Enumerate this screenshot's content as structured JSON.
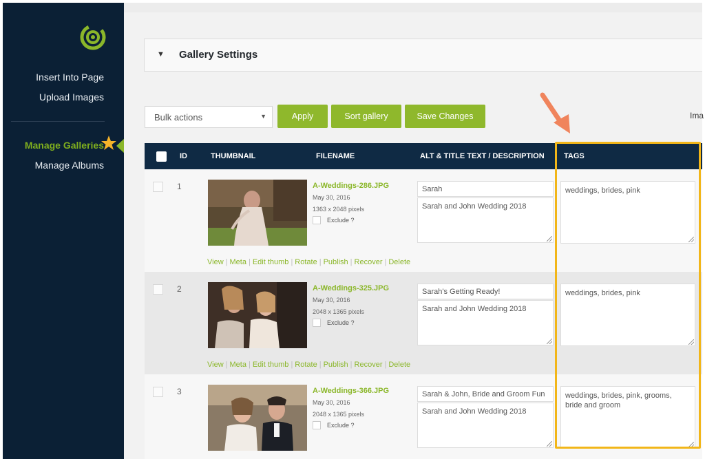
{
  "sidebar": {
    "logo_icon": "nextgen-logo-icon",
    "items": [
      {
        "label": "Insert Into Page"
      },
      {
        "label": "Upload Images"
      },
      {
        "label": "Manage Galleries",
        "active": true
      },
      {
        "label": "Manage Albums"
      }
    ]
  },
  "gallery_settings": {
    "title": "Gallery Settings"
  },
  "toolbar": {
    "bulk_actions": "Bulk actions",
    "apply": "Apply",
    "sort_gallery": "Sort gallery",
    "save_changes": "Save Changes",
    "truncated_label": "Ima"
  },
  "table": {
    "headers": {
      "id": "ID",
      "thumbnail": "THUMBNAIL",
      "filename": "FILENAME",
      "alt": "ALT & TITLE TEXT / DESCRIPTION",
      "tags": "TAGS"
    },
    "rows": [
      {
        "id": "1",
        "filename": "A-Weddings-286.JPG",
        "date": "May 30, 2016",
        "dimensions": "1363 x 2048 pixels",
        "exclude": "Exclude ?",
        "alt": "Sarah",
        "description": "Sarah and John Wedding 2018",
        "tags": "weddings, brides, pink"
      },
      {
        "id": "2",
        "filename": "A-Weddings-325.JPG",
        "date": "May 30, 2016",
        "dimensions": "2048 x 1365 pixels",
        "exclude": "Exclude ?",
        "alt": "Sarah's Getting Ready!",
        "description": "Sarah and John Wedding 2018",
        "tags": "weddings, brides, pink"
      },
      {
        "id": "3",
        "filename": "A-Weddings-366.JPG",
        "date": "May 30, 2016",
        "dimensions": "2048 x 1365 pixels",
        "exclude": "Exclude ?",
        "alt": "Sarah & John, Bride and Groom Fun",
        "description": "Sarah and John Wedding 2018",
        "tags": "weddings, brides, pink, grooms, bride and groom"
      }
    ],
    "row_actions": [
      "View",
      "Meta",
      "Edit thumb",
      "Rotate",
      "Publish",
      "Recover",
      "Delete"
    ]
  },
  "colors": {
    "sidebar_bg": "#0b2035",
    "accent_green": "#8bb72a",
    "header_bg": "#0f2a44",
    "highlight": "#f2b619",
    "arrow": "#f0845c"
  }
}
